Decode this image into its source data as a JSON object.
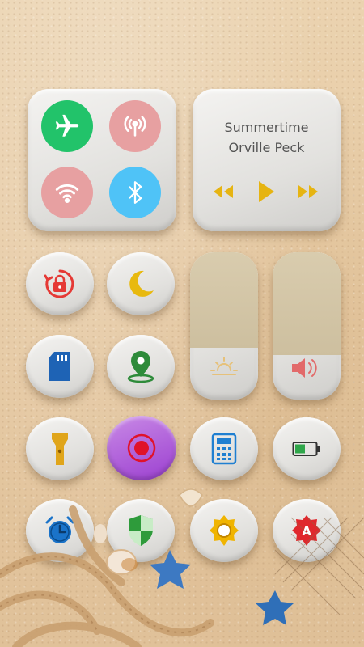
{
  "music": {
    "title": "Summertime",
    "artist": "Orville Peck"
  },
  "quick_settings": [
    {
      "name": "airplane-mode",
      "icon": "airplane-icon",
      "color": "#22c36a",
      "active": true
    },
    {
      "name": "hotspot",
      "icon": "hotspot-icon",
      "color": "#e7a0a1",
      "active": false
    },
    {
      "name": "wifi",
      "icon": "wifi-icon",
      "color": "#e7a0a1",
      "active": false
    },
    {
      "name": "bluetooth",
      "icon": "bluetooth-icon",
      "color": "#4fc3f7",
      "active": true
    }
  ],
  "apps": [
    {
      "name": "rotation-lock",
      "icon": "rotation-lock-icon",
      "color": "#e53935"
    },
    {
      "name": "night-mode",
      "icon": "moon-icon",
      "color": "#e8b90e"
    },
    {
      "name": "sd-card",
      "icon": "sd-card-icon",
      "color": "#1e63b5"
    },
    {
      "name": "location",
      "icon": "location-pin-icon",
      "color": "#2e8b3a"
    },
    {
      "name": "flashlight",
      "icon": "flashlight-icon",
      "color": "#e0a51a"
    },
    {
      "name": "screen-record",
      "icon": "record-icon",
      "color": "#b052d8"
    },
    {
      "name": "calculator",
      "icon": "calculator-icon",
      "color": "#1f7fd1"
    },
    {
      "name": "battery",
      "icon": "battery-icon",
      "color": "#2fa64a"
    },
    {
      "name": "alarm",
      "icon": "alarm-clock-icon",
      "color": "#1a73c9"
    },
    {
      "name": "security",
      "icon": "shield-icon",
      "color": "#2e9b3b"
    },
    {
      "name": "settings",
      "icon": "settings-sun-icon",
      "color": "#f0b400"
    },
    {
      "name": "app-a",
      "icon": "letter-a-icon",
      "color": "#e0282d"
    }
  ],
  "sliders": {
    "brightness_level": 0.35,
    "volume_level": 0.3
  }
}
